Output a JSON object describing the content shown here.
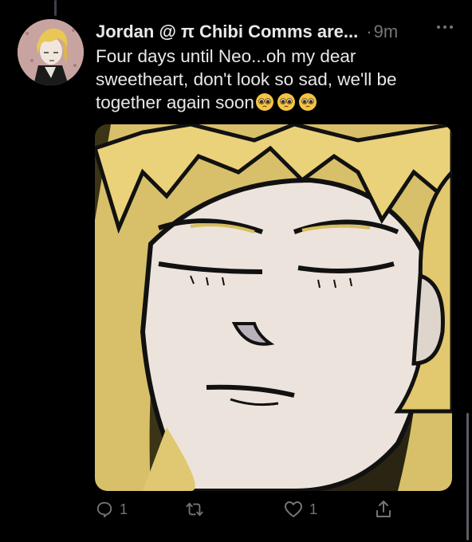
{
  "tweet": {
    "display_name": "Jordan @ π Chibi Comms are...",
    "separator": "·",
    "time": "9m",
    "text": "Four days until Neo...oh my dear sweetheart, don't look so sad, we'll be together again soon",
    "emoji": [
      "pleading-face-emoji",
      "pleading-face-emoji",
      "pleading-face-emoji"
    ]
  },
  "actions": {
    "reply_count": "1",
    "retweet_count": "",
    "like_count": "1"
  },
  "colors": {
    "background": "#000000",
    "text": "#e7e9ea",
    "secondary": "#71767b"
  }
}
